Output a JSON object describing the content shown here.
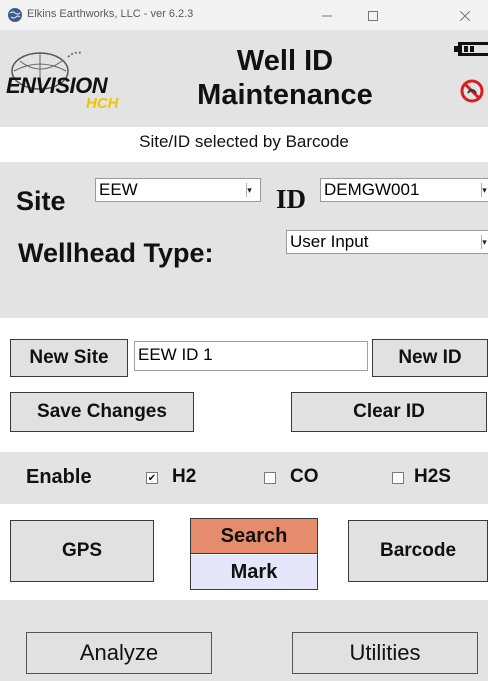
{
  "window": {
    "title": "Elkins Earthworks, LLC - ver 6.2.3"
  },
  "header": {
    "title_line1": "Well ID",
    "title_line2": "Maintenance",
    "logo_text": "ENVISION",
    "logo_subtext": "HCH"
  },
  "subtitle": "Site/ID selected by Barcode",
  "site": {
    "label": "Site",
    "value": "EEW"
  },
  "id": {
    "label": "ID",
    "value": "DEMGW001"
  },
  "wellhead": {
    "label": "Wellhead Type:",
    "value": "User Input"
  },
  "new_site": {
    "button": "New Site",
    "input_value": "EEW ID 1",
    "new_id_button": "New ID"
  },
  "actions": {
    "save": "Save Changes",
    "clear": "Clear ID"
  },
  "enable": {
    "label": "Enable",
    "options": [
      {
        "label": "H2",
        "checked": true
      },
      {
        "label": "CO",
        "checked": false
      },
      {
        "label": "H2S",
        "checked": false
      }
    ]
  },
  "location": {
    "gps": "GPS",
    "search": "Search",
    "mark": "Mark",
    "barcode": "Barcode"
  },
  "footer": {
    "analyze": "Analyze",
    "utilities": "Utilities"
  },
  "colors": {
    "band": "#e3e3e3",
    "search_bg": "#e48c6c",
    "mark_bg": "#e6e6fa"
  },
  "check_mark": "✔"
}
